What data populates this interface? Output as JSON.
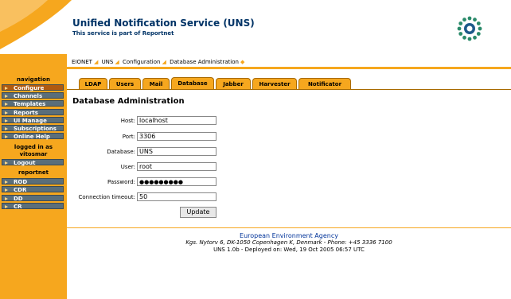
{
  "header": {
    "title": "Unified Notification Service (UNS)",
    "subtitle": "This service is part of Reportnet"
  },
  "breadcrumbs": [
    "EIONET",
    "UNS",
    "Configuration",
    "Database Administration"
  ],
  "nav": {
    "heading": "navigation",
    "items": [
      {
        "label": "Configure",
        "active": true
      },
      {
        "label": "Channels",
        "active": false
      },
      {
        "label": "Templates",
        "active": false
      },
      {
        "label": "Reports",
        "active": false
      },
      {
        "label": "UI Manage",
        "active": false
      },
      {
        "label": "Subscriptions",
        "active": false
      },
      {
        "label": "Online Help",
        "active": false
      }
    ],
    "logged_in_label": "logged in as",
    "username": "vitosmar",
    "logout_label": "Logout",
    "reportnet_heading": "reportnet",
    "reportnet_items": [
      "ROD",
      "CDR",
      "DD",
      "CR"
    ]
  },
  "tabs": [
    {
      "label": "LDAP",
      "active": false
    },
    {
      "label": "Users",
      "active": false
    },
    {
      "label": "Mail",
      "active": false
    },
    {
      "label": "Database",
      "active": true
    },
    {
      "label": "Jabber",
      "active": false
    },
    {
      "label": "Harvester",
      "active": false
    },
    {
      "label": "Notificator",
      "active": false
    }
  ],
  "page_title": "Database Administration",
  "form": {
    "fields": [
      {
        "label": "Host:",
        "value": "localhost"
      },
      {
        "label": "Port:",
        "value": "3306"
      },
      {
        "label": "Database:",
        "value": "UNS"
      },
      {
        "label": "User:",
        "value": "root"
      },
      {
        "label": "Password:",
        "value": "●●●●●●●●●"
      },
      {
        "label": "Connection timeout:",
        "value": "50"
      }
    ],
    "submit_label": "Update"
  },
  "footer": {
    "agency": "European Environment Agency",
    "address": "Kgs. Nytorv 6, DK-1050 Copenhagen K, Denmark - Phone: +45 3336 7100",
    "version": "UNS 1.0b - Deployed on: Wed, 19 Oct 2005 06:57 UTC"
  },
  "colors": {
    "accent": "#f6a71e",
    "nav_item": "#5a6e7a",
    "title": "#003366"
  }
}
